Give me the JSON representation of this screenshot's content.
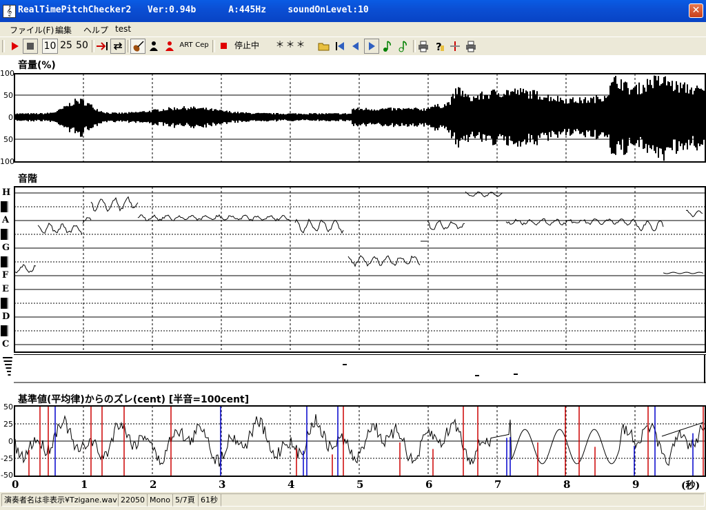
{
  "window": {
    "title": "RealTimePitchChecker2   Ver:0.94b      A:445Hz    soundOnLevel:10",
    "app_icon": "treble-clef-icon",
    "close_label": "✕"
  },
  "menu": [
    "ファイル(F)",
    "編集",
    "ヘルプ",
    "test"
  ],
  "toolbar": {
    "speed_10": "10",
    "speed_25": "25",
    "speed_50": "50",
    "art_label": "ART",
    "cep_label": "Cep",
    "status_text": "停止中",
    "display": "＊＊＊"
  },
  "volume_panel": {
    "title": "音量(%)",
    "ylabels": [
      "100",
      "50",
      "0",
      "50",
      "100"
    ]
  },
  "pitch_panel": {
    "title": "音階",
    "notes": [
      "H",
      "A",
      "G",
      "F",
      "E",
      "D",
      "C"
    ]
  },
  "deviation_panel": {
    "title": "基準値(平均律)からのズレ(cent) [半音=100cent]",
    "ylabels": [
      "50",
      "25",
      "0",
      "-25",
      "-50"
    ]
  },
  "x_axis": {
    "ticks": [
      "0",
      "1",
      "2",
      "3",
      "4",
      "5",
      "6",
      "7",
      "8",
      "9"
    ],
    "unit": "(秒)"
  },
  "statusbar": {
    "file": "演奏者名は非表示¥Tzigane.wav",
    "rate": "22050",
    "channels": "Mono",
    "page": "5/7頁",
    "duration": "61秒"
  },
  "colors": {
    "accent_red": "#cc0000",
    "accent_blue": "#0000cc",
    "titlebar": "#0b4fd4"
  }
}
